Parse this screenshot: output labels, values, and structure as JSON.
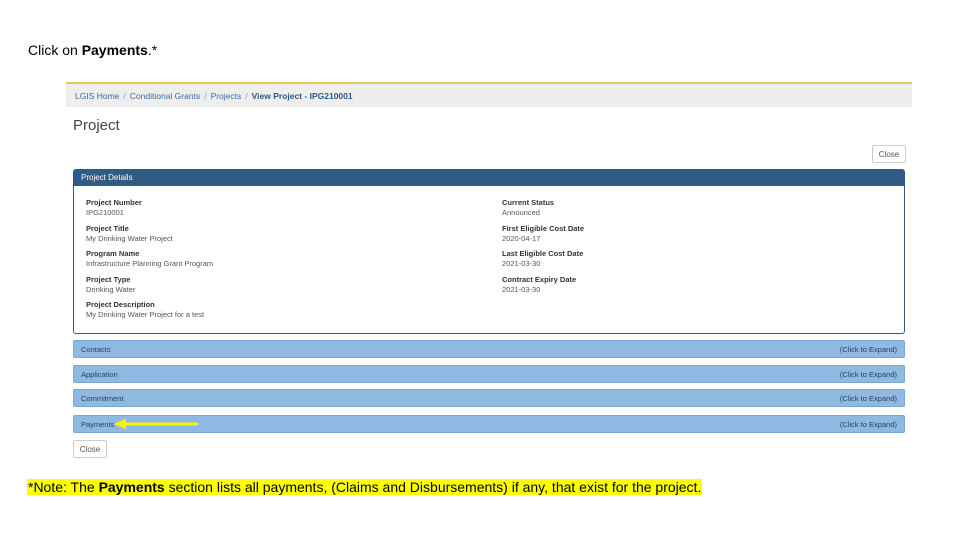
{
  "instruction": {
    "prefix": "Click on ",
    "target": "Payments",
    "suffix": ".*"
  },
  "breadcrumb": {
    "items": [
      "LGIS Home",
      "Conditional Grants",
      "Projects"
    ],
    "current": "View Project - IPG210001",
    "separator": "/"
  },
  "page": {
    "title": "Project",
    "close_label": "Close"
  },
  "project_details": {
    "heading": "Project Details",
    "left_fields": [
      {
        "label": "Project Number",
        "value": "IPG210001"
      },
      {
        "label": "Project Title",
        "value": "My Drinking Water Project"
      },
      {
        "label": "Program Name",
        "value": "Infrastructure Planning Grant Program"
      },
      {
        "label": "Project Type",
        "value": "Drinking Water"
      },
      {
        "label": "Project Description",
        "value": "My Drinking Water Project for a test"
      }
    ],
    "right_fields": [
      {
        "label": "Current Status",
        "value": "Announced"
      },
      {
        "label": "First Eligible Cost Date",
        "value": "2020-04-17"
      },
      {
        "label": "Last Eligible Cost Date",
        "value": "2021-03-30"
      },
      {
        "label": "Contract Expiry Date",
        "value": "2021-03-30"
      }
    ]
  },
  "sections": [
    {
      "label": "Contacts",
      "expand": "(Click to Expand)"
    },
    {
      "label": "Application",
      "expand": "(Click to Expand)"
    },
    {
      "label": "Commitment",
      "expand": "(Click to Expand)"
    },
    {
      "label": "Payments",
      "expand": "(Click to Expand)"
    }
  ],
  "note": {
    "prefix": "*Note: The ",
    "bold": "Payments",
    "suffix": " section lists all payments, (Claims and Disbursements) if any, that exist for the project."
  },
  "colors": {
    "panel_heading": "#2f5b85",
    "section_bar": "#8fb9e3",
    "highlight": "#ffff00",
    "arrow": "#f2f200"
  },
  "icons": {
    "pointer": "arrow-left-icon"
  }
}
